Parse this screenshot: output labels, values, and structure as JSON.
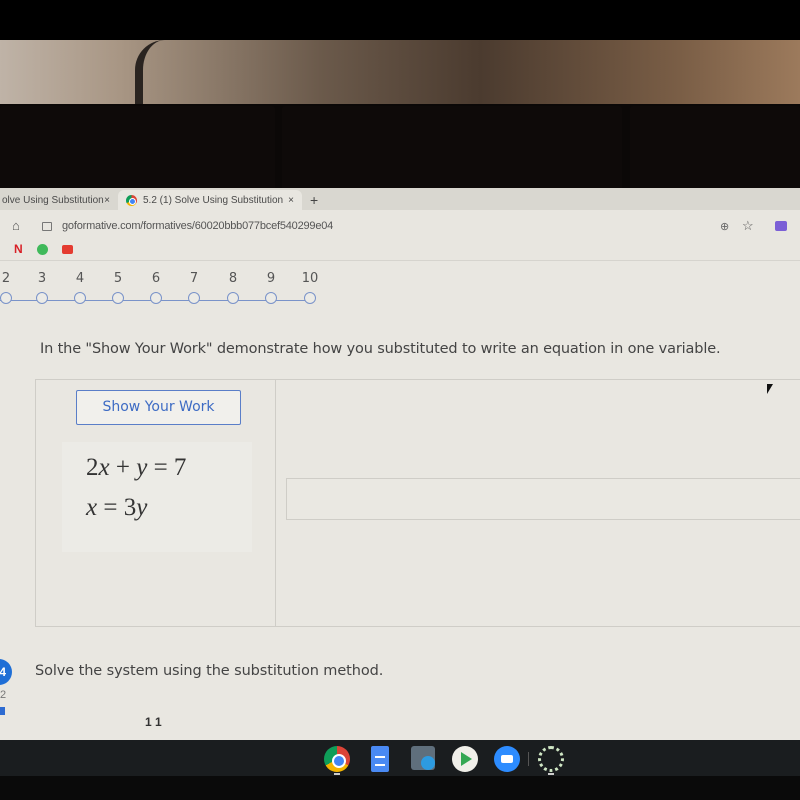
{
  "browser": {
    "tabs": [
      {
        "label": "olve Using Substitution",
        "close": "×",
        "active": false
      },
      {
        "label": "5.2 (1) Solve Using Substitution",
        "close": "×",
        "active": true
      }
    ],
    "new_tab": "+",
    "url": "goformative.com/formatives/60020bbb077bcef540299e04",
    "bookmarks": [
      {
        "icon": "netflix-icon",
        "glyph": "N"
      },
      {
        "icon": "spotify-icon"
      },
      {
        "icon": "youtube-icon"
      }
    ],
    "toolbar_icons": {
      "home": "⌂",
      "zoom": "⊕",
      "star": "☆"
    }
  },
  "stepper": {
    "steps": [
      "2",
      "3",
      "4",
      "5",
      "6",
      "7",
      "8",
      "9",
      "10"
    ]
  },
  "question3": {
    "prompt": "In the \"Show Your Work\" demonstrate how you substituted to write an equation in one variable.",
    "show_work_label": "Show Your Work",
    "equations": [
      "2x + y = 7",
      "x = 3y"
    ],
    "answer_value": ""
  },
  "question4": {
    "number": "4",
    "text": "Solve the system using the substitution method.",
    "points": "2",
    "cut_text": "1 1"
  },
  "shelf": {
    "apps": [
      "chrome",
      "google-docs",
      "calculator",
      "play-store",
      "zoom",
      "loading"
    ]
  }
}
